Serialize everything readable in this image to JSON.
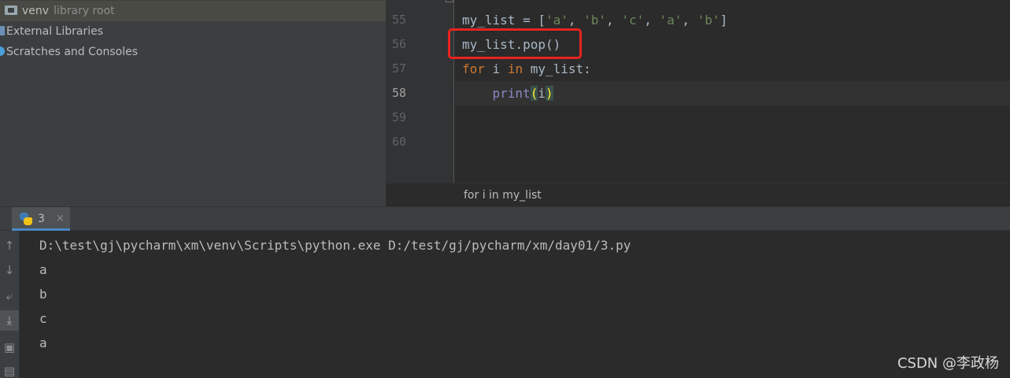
{
  "project_tree": {
    "venv_label": "venv",
    "venv_hint": "library root",
    "external_libraries": "External Libraries",
    "scratches": "Scratches and Consoles"
  },
  "editor": {
    "lines": [
      {
        "number": "55",
        "tokens": [
          {
            "t": "my_list = [",
            "c": ""
          },
          {
            "t": "'a'",
            "c": "str"
          },
          {
            "t": ", ",
            "c": ""
          },
          {
            "t": "'b'",
            "c": "str"
          },
          {
            "t": ", ",
            "c": ""
          },
          {
            "t": "'c'",
            "c": "str"
          },
          {
            "t": ", ",
            "c": ""
          },
          {
            "t": "'a'",
            "c": "str"
          },
          {
            "t": ", ",
            "c": ""
          },
          {
            "t": "'b'",
            "c": "str"
          },
          {
            "t": "]",
            "c": ""
          }
        ]
      },
      {
        "number": "56",
        "tokens": [
          {
            "t": "my_list.pop()",
            "c": ""
          }
        ]
      },
      {
        "number": "57",
        "tokens": [
          {
            "t": "for",
            "c": "kw"
          },
          {
            "t": " i ",
            "c": ""
          },
          {
            "t": "in",
            "c": "kw"
          },
          {
            "t": " my_list:",
            "c": ""
          }
        ]
      },
      {
        "number": "58",
        "tokens": [
          {
            "t": "    ",
            "c": ""
          },
          {
            "t": "print",
            "c": "builtin"
          },
          {
            "t": "(",
            "c": "paren-match"
          },
          {
            "t": "i",
            "c": ""
          },
          {
            "t": ")",
            "c": "paren-match"
          }
        ]
      },
      {
        "number": "59",
        "tokens": []
      },
      {
        "number": "60",
        "tokens": []
      }
    ],
    "caret_line": "58",
    "breadcrumb": "for i in my_list"
  },
  "run_window": {
    "tab_label": "3",
    "tab_close": "×",
    "toolbar_icons": [
      "arrow-up-icon",
      "arrow-down-icon",
      "soft-wrap-icon",
      "scroll-to-end-icon",
      "print-icon",
      "trash-icon"
    ],
    "console_lines": [
      "D:\\test\\gj\\pycharm\\xm\\venv\\Scripts\\python.exe D:/test/gj/pycharm/xm/day01/3.py",
      "a",
      "b",
      "c",
      "a"
    ]
  },
  "colors": {
    "highlight_box": "#e8231f",
    "keyword": "#cc7832",
    "string": "#6a8759",
    "builtin": "#8888c6"
  },
  "watermark": "CSDN @李政杨"
}
